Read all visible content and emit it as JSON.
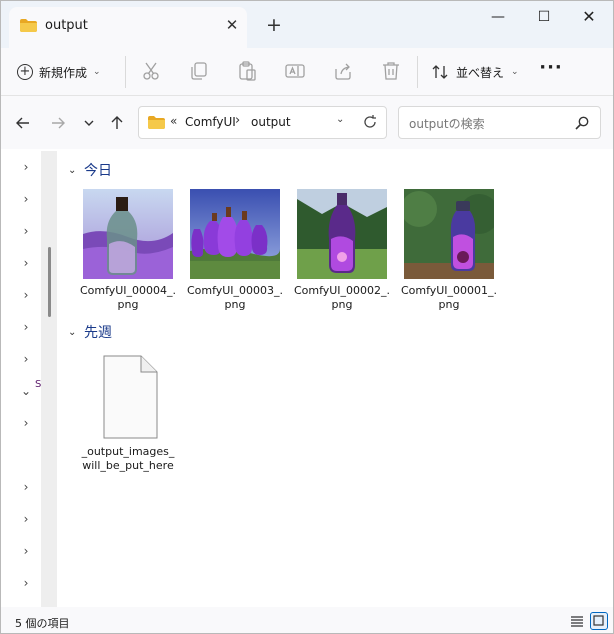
{
  "window": {
    "tab_title": "output"
  },
  "commands": {
    "new_label": "新規作成",
    "sort_label": "並べ替え"
  },
  "address": {
    "seg1": "ComfyUI",
    "seg2": "output",
    "chevron": "«",
    "sep": "›"
  },
  "search": {
    "placeholder": "outputの検索"
  },
  "groups": [
    {
      "label": "今日"
    },
    {
      "label": "先週"
    }
  ],
  "files": [
    {
      "name": "ComfyUI_00004_.png",
      "line1": "ComfyUI_00004_.",
      "line2": "png"
    },
    {
      "name": "ComfyUI_00003_.png",
      "line1": "ComfyUI_00003_.",
      "line2": "png"
    },
    {
      "name": "ComfyUI_00002_.png",
      "line1": "ComfyUI_00002_.",
      "line2": "png"
    },
    {
      "name": "ComfyUI_00001_.png",
      "line1": "ComfyUI_00001_.",
      "line2": "png"
    },
    {
      "name": "_output_images_will_be_put_here",
      "line1": "_output_images_",
      "line2": "will_be_put_here"
    }
  ],
  "sidebar": {
    "truncated": "S"
  },
  "status": {
    "count": "5 個の項目"
  },
  "colors": {
    "accent": "#0067c0",
    "folder": "#f2c14e",
    "group_header": "#1a3a8a"
  },
  "icons": [
    "folder-icon",
    "close-icon",
    "plus-icon",
    "minimize-icon",
    "maximize-icon",
    "cut-icon",
    "copy-icon",
    "paste-icon",
    "rename-icon",
    "share-icon",
    "delete-icon",
    "sort-icon",
    "more-icon",
    "back-icon",
    "forward-icon",
    "recent-icon",
    "up-icon",
    "refresh-icon",
    "search-icon",
    "details-view-icon",
    "tiles-view-icon",
    "file-icon"
  ]
}
